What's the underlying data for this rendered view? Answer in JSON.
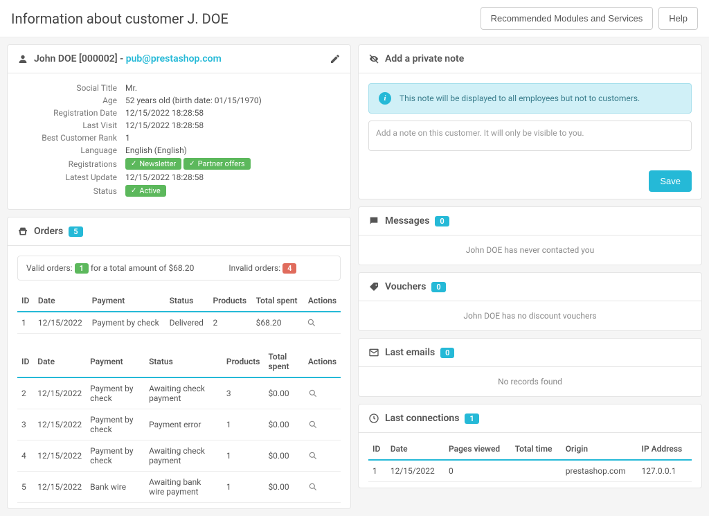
{
  "header": {
    "title": "Information about customer J. DOE",
    "recommended_btn": "Recommended Modules and Services",
    "help_btn": "Help"
  },
  "customer": {
    "name": "John DOE [000002]",
    "email": "pub@prestashop.com",
    "separator": " - ",
    "rows": {
      "social_title": {
        "label": "Social Title",
        "value": "Mr."
      },
      "age": {
        "label": "Age",
        "value": "52 years old (birth date: 01/15/1970)"
      },
      "registration_date": {
        "label": "Registration Date",
        "value": "12/15/2022 18:28:58"
      },
      "last_visit": {
        "label": "Last Visit",
        "value": "12/15/2022 18:28:58"
      },
      "best_rank": {
        "label": "Best Customer Rank",
        "value": "1"
      },
      "language": {
        "label": "Language",
        "value": "English (English)"
      },
      "registrations": {
        "label": "Registrations",
        "badge_newsletter": "Newsletter",
        "badge_partner": "Partner offers"
      },
      "latest_update": {
        "label": "Latest Update",
        "value": "12/15/2022 18:28:58"
      },
      "status": {
        "label": "Status",
        "badge": "Active"
      }
    }
  },
  "orders": {
    "title": "Orders",
    "count": "5",
    "summary": {
      "valid_prefix": "Valid orders:",
      "valid_count": "1",
      "valid_suffix": "for a total amount of $68.20",
      "invalid_prefix": "Invalid orders:",
      "invalid_count": "4"
    },
    "columns": {
      "id": "ID",
      "date": "Date",
      "payment": "Payment",
      "status": "Status",
      "products": "Products",
      "total": "Total spent",
      "actions": "Actions"
    },
    "valid_rows": [
      {
        "id": "1",
        "date": "12/15/2022",
        "payment": "Payment by check",
        "status": "Delivered",
        "products": "2",
        "total": "$68.20"
      }
    ],
    "invalid_rows": [
      {
        "id": "2",
        "date": "12/15/2022",
        "payment": "Payment by check",
        "status": "Awaiting check payment",
        "products": "3",
        "total": "$0.00"
      },
      {
        "id": "3",
        "date": "12/15/2022",
        "payment": "Payment by check",
        "status": "Payment error",
        "products": "1",
        "total": "$0.00"
      },
      {
        "id": "4",
        "date": "12/15/2022",
        "payment": "Payment by check",
        "status": "Awaiting check payment",
        "products": "1",
        "total": "$0.00"
      },
      {
        "id": "5",
        "date": "12/15/2022",
        "payment": "Bank wire",
        "status": "Awaiting bank wire payment",
        "products": "1",
        "total": "$0.00"
      }
    ]
  },
  "note": {
    "title": "Add a private note",
    "alert": "This note will be displayed to all employees but not to customers.",
    "placeholder": "Add a note on this customer. It will only be visible to you.",
    "save": "Save"
  },
  "messages": {
    "title": "Messages",
    "count": "0",
    "empty": "John DOE has never contacted you"
  },
  "vouchers": {
    "title": "Vouchers",
    "count": "0",
    "empty": "John DOE has no discount vouchers"
  },
  "emails": {
    "title": "Last emails",
    "count": "0",
    "empty": "No records found"
  },
  "connections": {
    "title": "Last connections",
    "count": "1",
    "columns": {
      "id": "ID",
      "date": "Date",
      "pages": "Pages viewed",
      "time": "Total time",
      "origin": "Origin",
      "ip": "IP Address"
    },
    "rows": [
      {
        "id": "1",
        "date": "12/15/2022",
        "pages": "0",
        "time": "",
        "origin": "prestashop.com",
        "ip": "127.0.0.1"
      }
    ]
  }
}
